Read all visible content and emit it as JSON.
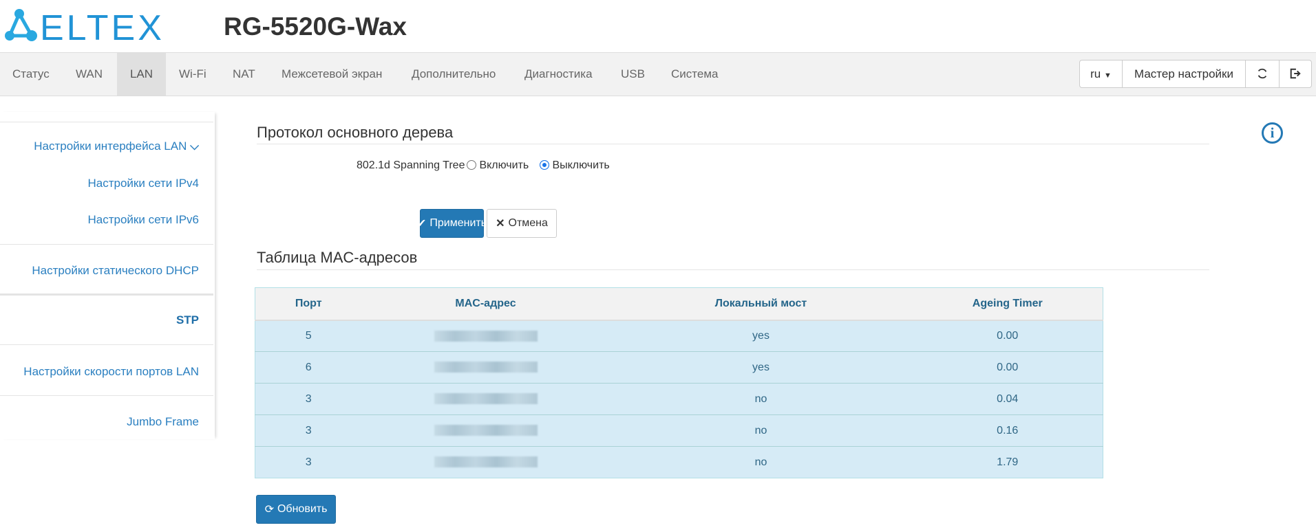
{
  "header": {
    "brand": "ELTEX",
    "model": "RG-5520G-Wax"
  },
  "nav": {
    "items": [
      "Статус",
      "WAN",
      "LAN",
      "Wi-Fi",
      "NAT",
      "Межсетевой экран",
      "Дополнительно",
      "Диагностика",
      "USB",
      "Система"
    ],
    "active": "LAN"
  },
  "tools": {
    "lang": "ru",
    "wizard": "Мастер настройки"
  },
  "sidebar": {
    "items": [
      "Настройки интерфейса LAN",
      "Настройки сети IPv4",
      "Настройки сети IPv6",
      "Настройки статического DHCP",
      "STP",
      "Настройки скорости портов LAN",
      "Jumbo Frame"
    ],
    "active": "STP"
  },
  "stp": {
    "heading": "Протокол основного дерева",
    "label": "802.1d Spanning Tree",
    "enable": "Включить",
    "disable": "Выключить",
    "selected": "Выключить",
    "apply": "Применить",
    "cancel": "Отмена"
  },
  "mac_table": {
    "heading": "Таблица MAC-адресов",
    "columns": [
      "Порт",
      "MAC-адрес",
      "Локальный мост",
      "Ageing Timer"
    ],
    "rows": [
      {
        "port": "5",
        "local": "yes",
        "ageing": "0.00"
      },
      {
        "port": "6",
        "local": "yes",
        "ageing": "0.00"
      },
      {
        "port": "3",
        "local": "no",
        "ageing": "0.04"
      },
      {
        "port": "3",
        "local": "no",
        "ageing": "0.16"
      },
      {
        "port": "3",
        "local": "no",
        "ageing": "1.79"
      }
    ],
    "refresh": "Обновить"
  },
  "colors": {
    "accent": "#2479b5",
    "link": "#2a7fc0",
    "row": "#d6ebf6"
  }
}
